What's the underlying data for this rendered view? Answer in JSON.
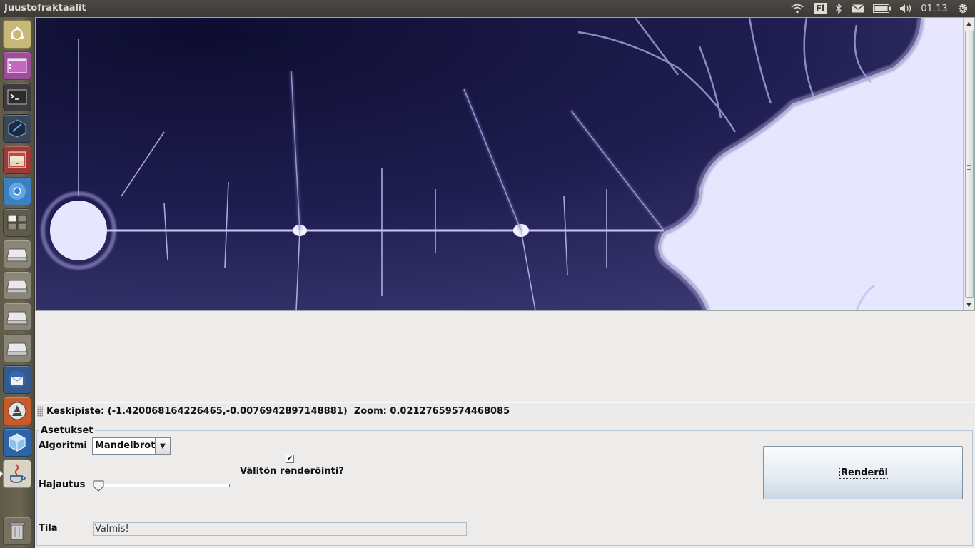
{
  "window": {
    "title": "Juustofraktaalit"
  },
  "top_panel": {
    "keyboard_layout": "Fi",
    "clock": "01.13",
    "indicators": [
      "wifi-icon",
      "bluetooth-icon",
      "mail-icon",
      "battery-icon",
      "volume-icon",
      "power-gear-icon"
    ]
  },
  "launcher": {
    "items": [
      "dash-home",
      "files",
      "terminal",
      "ide",
      "archive-manager",
      "chromium",
      "workspace-switcher",
      "drive-1",
      "drive-2",
      "drive-3",
      "drive-4",
      "thunderbird",
      "software-updater",
      "virtualbox",
      "java-app",
      "trash"
    ]
  },
  "status": {
    "center_label": "Keskipiste:",
    "center_value": "(-1.420068164226465,-0.0076942897148881)",
    "zoom_label": "Zoom:",
    "zoom_value": "0.02127659574468085"
  },
  "settings": {
    "group_title": "Asetukset",
    "algorithm_label": "Algoritmi",
    "algorithm_value": "Mandelbrot",
    "instant_render_label": "Välitön renderöinti?",
    "instant_render_checked": true,
    "spread_label": "Hajautus",
    "spread_value": 0,
    "render_button": "Renderöi",
    "state_label": "Tila",
    "state_value": "Valmis!"
  },
  "colors": {
    "fractal_inside": "#e8e6ff",
    "fractal_dark": "#13123a",
    "fractal_mid": "#3b3872"
  }
}
